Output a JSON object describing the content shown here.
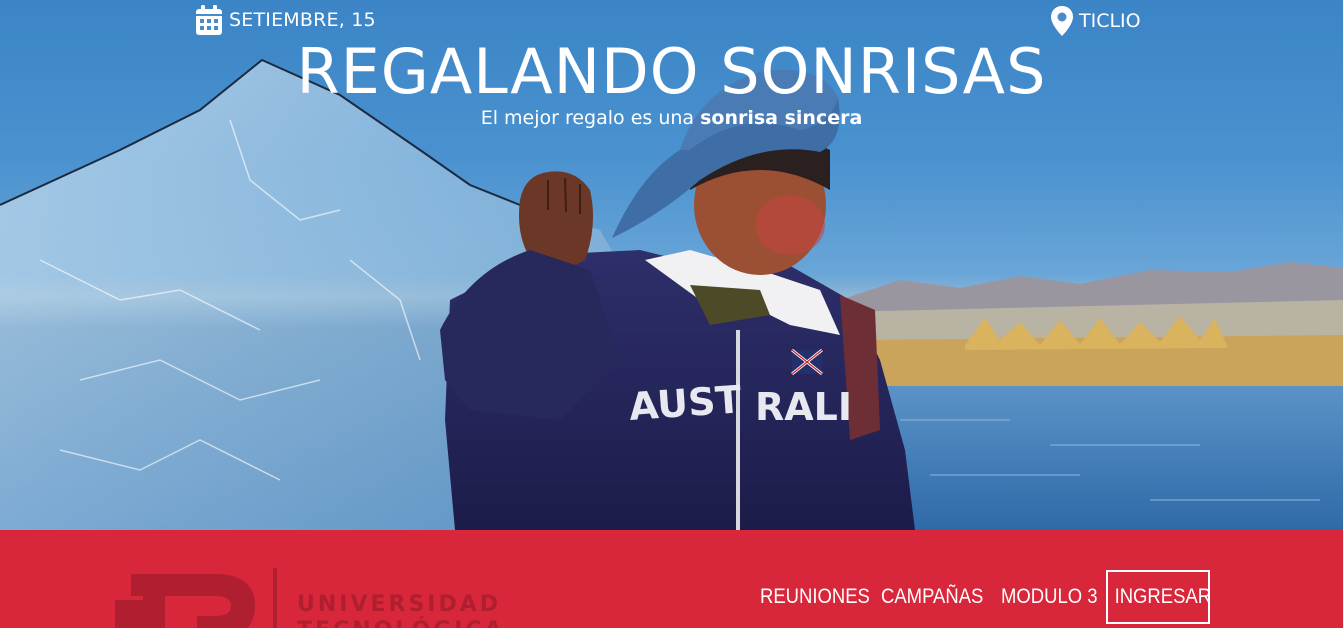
{
  "event": {
    "date": "SETIEMBRE, 15",
    "location": "TICLIO",
    "date_icon": "calendar-icon",
    "location_icon": "map-pin-icon"
  },
  "hero": {
    "title": "REGALANDO SONRISAS",
    "subtitle_prefix": "El mejor regalo es una ",
    "subtitle_emphasis": "sonrisa sincera"
  },
  "footer": {
    "logo_text_line1": "UNIVERSIDAD",
    "logo_text_line2": "TECNOLÓGICA",
    "nav": [
      "REUNIONES",
      "CAMPAÑAS",
      "MODULO 3"
    ],
    "login_label": "INGRESAR"
  },
  "colors": {
    "brand_red": "#d8263a",
    "logo_red": "#b01f30",
    "text": "#ffffff"
  }
}
